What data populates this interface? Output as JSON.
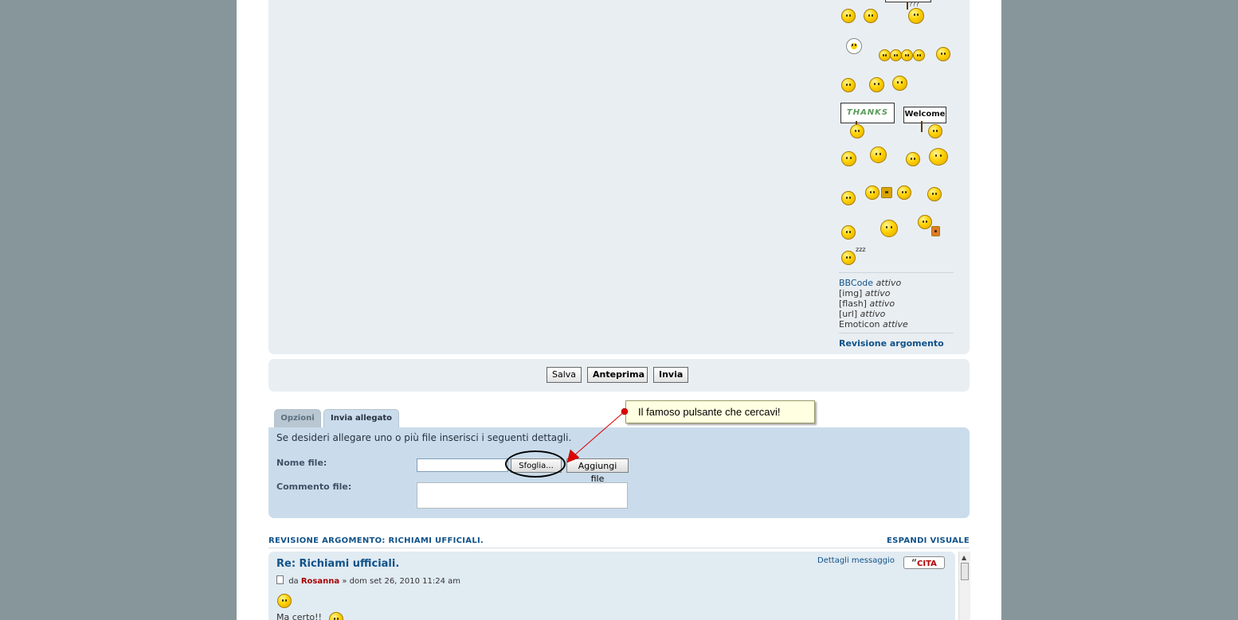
{
  "editor": {
    "sign_question": "???",
    "sign_thanks": "THANKS",
    "sign_welcome": "Welcome",
    "sign_zzz": "zzz",
    "bbcode_link": "BBCode",
    "bbcode_status": "attivo",
    "img_label": "[img]",
    "img_status": "attivo",
    "flash_label": "[flash]",
    "flash_status": "attivo",
    "url_label": "[url]",
    "url_status": "attivo",
    "emoticon_label": "Emoticon",
    "emoticon_status": "attive",
    "revision_link": "Revisione argomento"
  },
  "buttons": {
    "save": "Salva",
    "preview": "Anteprima",
    "submit": "Invia"
  },
  "tabs": {
    "options": "Opzioni",
    "attach": "Invia allegato"
  },
  "attachment": {
    "intro": "Se desideri allegare uno o più file inserisci i seguenti dettagli.",
    "filename_label": "Nome file:",
    "browse_button": "Sfoglia...",
    "add_file_button": "Aggiungi file",
    "comment_label": "Commento file:",
    "file_value": "",
    "comment_value": ""
  },
  "annotation": {
    "callout_text": "Il famoso pulsante che cercavi!",
    "arrow_color": "#dd0000"
  },
  "review": {
    "heading": "REVISIONE ARGOMENTO: RICHIAMI UFFICIALI.",
    "expand": "ESPANDI VISUALE",
    "post_title": "Re: Richiami ufficiali.",
    "by": "da",
    "author": "Rosanna",
    "date": "» dom set 26, 2010 11:24 am",
    "details_link": "Dettagli messaggio",
    "quote_button": "CITA",
    "body_text": "Ma certo!!"
  },
  "colors": {
    "background": "#87969a",
    "panel": "#e9eef2",
    "attach_panel": "#cadceb",
    "link": "#105289",
    "author": "#aa0000"
  }
}
